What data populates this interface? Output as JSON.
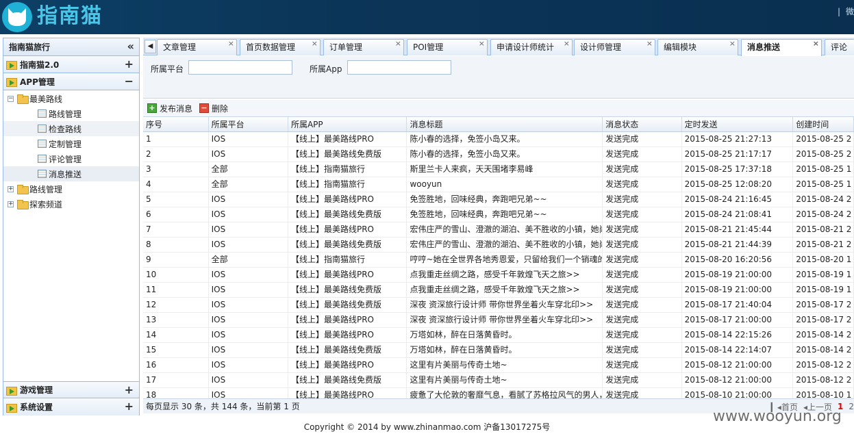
{
  "header": {
    "brand": "指南猫",
    "right_text": "微"
  },
  "sidebar": {
    "title": "指南猫旅行",
    "collapse_icon": "«",
    "sections": [
      {
        "label": "指南猫2.0",
        "toggle": "+"
      },
      {
        "label": "APP管理",
        "toggle": "−"
      }
    ],
    "tree": [
      {
        "label": "最美路线",
        "level": 0,
        "exp": "−",
        "type": "folder"
      },
      {
        "label": "路线管理",
        "level": 1,
        "type": "page"
      },
      {
        "label": "检查路线",
        "level": 1,
        "type": "page"
      },
      {
        "label": "定制管理",
        "level": 1,
        "type": "page"
      },
      {
        "label": "评论管理",
        "level": 1,
        "type": "page"
      },
      {
        "label": "消息推送",
        "level": 1,
        "type": "page"
      },
      {
        "label": "路线管理",
        "level": 0,
        "exp": "+",
        "type": "folder"
      },
      {
        "label": "探索频道",
        "level": 0,
        "exp": "+",
        "type": "folder"
      }
    ],
    "bottom_sections": [
      {
        "label": "游戏管理",
        "toggle": "+"
      },
      {
        "label": "系统设置",
        "toggle": "+"
      }
    ]
  },
  "tabs": [
    {
      "label": "文章管理"
    },
    {
      "label": "首页数据管理"
    },
    {
      "label": "订单管理"
    },
    {
      "label": "POI管理"
    },
    {
      "label": "申请设计师统计"
    },
    {
      "label": "设计师管理"
    },
    {
      "label": "编辑模块"
    },
    {
      "label": "消息推送",
      "active": true
    },
    {
      "label": "评论管"
    }
  ],
  "filter": {
    "platform_label": "所属平台",
    "app_label": "所属App",
    "platform_value": "",
    "app_value": ""
  },
  "toolbar": {
    "publish_label": "发布消息",
    "delete_label": "删除"
  },
  "table": {
    "columns": [
      "序号",
      "所属平台",
      "所属APP",
      "消息标题",
      "消息状态",
      "定时发送",
      "创建时间"
    ],
    "rows": [
      [
        "1",
        "IOS",
        "【线上】最美路线PRO",
        "陈小春的选择，免签小岛又来。",
        "发送完成",
        "2015-08-25 21:27:13",
        "2015-08-25 2"
      ],
      [
        "2",
        "IOS",
        "【线上】最美路线免费版",
        "陈小春的选择，免签小岛又来。",
        "发送完成",
        "2015-08-25 21:17:17",
        "2015-08-25 2"
      ],
      [
        "3",
        "全部",
        "【线上】指南猫旅行",
        "斯里兰卡人来疯，天天围堵李易峰",
        "发送完成",
        "2015-08-25 17:37:18",
        "2015-08-25 1"
      ],
      [
        "4",
        "全部",
        "【线上】指南猫旅行",
        "wooyun",
        "发送完成",
        "2015-08-25 12:08:20",
        "2015-08-25 1"
      ],
      [
        "5",
        "IOS",
        "【线上】最美路线PRO",
        "免签胜地，回味经典，奔跑吧兄弟~~",
        "发送完成",
        "2015-08-24 21:16:45",
        "2015-08-24 2"
      ],
      [
        "6",
        "IOS",
        "【线上】最美路线免费版",
        "免签胜地，回味经典，奔跑吧兄弟~~",
        "发送完成",
        "2015-08-24 21:08:41",
        "2015-08-24 2"
      ],
      [
        "7",
        "IOS",
        "【线上】最美路线PRO",
        "宏伟庄严的雪山、澄澈的湖泊、美不胜收的小镇，她尚",
        "发送完成",
        "2015-08-21 21:45:44",
        "2015-08-21 2"
      ],
      [
        "8",
        "IOS",
        "【线上】最美路线免费版",
        "宏伟庄严的雪山、澄澈的湖泊、美不胜收的小镇，她尚",
        "发送完成",
        "2015-08-21 21:44:39",
        "2015-08-21 2"
      ],
      [
        "9",
        "全部",
        "【线上】指南猫旅行",
        "哼哼~她在全世界各地秀恩爱，只留给我们一个销魂的",
        "发送完成",
        "2015-08-20 16:20:56",
        "2015-08-20 1"
      ],
      [
        "10",
        "IOS",
        "【线上】最美路线PRO",
        "点我重走丝绸之路，感受千年敦煌飞天之旅>>",
        "发送完成",
        "2015-08-19 21:00:00",
        "2015-08-19 1"
      ],
      [
        "11",
        "IOS",
        "【线上】最美路线免费版",
        "点我重走丝绸之路，感受千年敦煌飞天之旅>>",
        "发送完成",
        "2015-08-19 21:00:00",
        "2015-08-19 1"
      ],
      [
        "12",
        "IOS",
        "【线上】最美路线免费版",
        "深夜 资深旅行设计师 带你世界坐着火车穿北印>>",
        "发送完成",
        "2015-08-17 21:40:04",
        "2015-08-17 2"
      ],
      [
        "13",
        "IOS",
        "【线上】最美路线PRO",
        "深夜 资深旅行设计师 带你世界坐着火车穿北印>>",
        "发送完成",
        "2015-08-17 21:00:00",
        "2015-08-17 2"
      ],
      [
        "14",
        "IOS",
        "【线上】最美路线PRO",
        "万塔如林，醉在日落黄昏时。",
        "发送完成",
        "2015-08-14 22:15:26",
        "2015-08-14 2"
      ],
      [
        "15",
        "IOS",
        "【线上】最美路线免费版",
        "万塔如林，醉在日落黄昏时。",
        "发送完成",
        "2015-08-14 22:14:07",
        "2015-08-14 2"
      ],
      [
        "16",
        "IOS",
        "【线上】最美路线PRO",
        "这里有片美丽与传奇土地~",
        "发送完成",
        "2015-08-12 21:00:00",
        "2015-08-12 2"
      ],
      [
        "17",
        "IOS",
        "【线上】最美路线免费版",
        "这里有片美丽与传奇土地~",
        "发送完成",
        "2015-08-12 21:00:00",
        "2015-08-12 2"
      ],
      [
        "18",
        "IOS",
        "【线上】最美路线PRO",
        "疲惫了大伦敦的奢靡气息，看腻了苏格拉风气的男人，",
        "发送完成",
        "2015-08-10 21:00:00",
        "2015-08-10 1"
      ]
    ]
  },
  "pager": {
    "info": "每页显示 30 条，共 144 条，当前第 1 页",
    "first": "首页",
    "prev": "上一页",
    "page1": "1",
    "page2": "2"
  },
  "footer": {
    "text": "Copyright © 2014 by www.zhinanmao.com 沪备13017275号"
  },
  "watermark": "www.wooyun.org"
}
